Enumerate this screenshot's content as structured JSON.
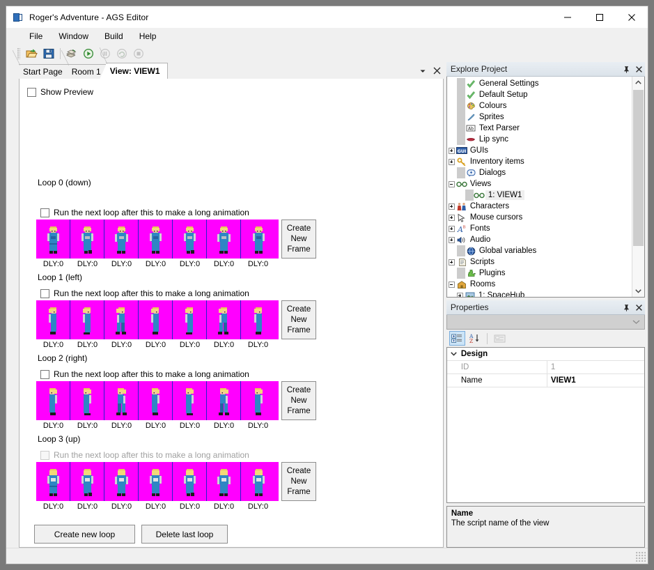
{
  "window": {
    "title": "Roger's Adventure - AGS Editor",
    "icon": "ags-app-icon",
    "controls": {
      "minimize": "minimize-icon",
      "maximize": "maximize-icon",
      "close": "close-icon"
    }
  },
  "menubar": {
    "items": [
      "File",
      "Window",
      "Build",
      "Help"
    ]
  },
  "toolbar": {
    "buttons": [
      {
        "name": "open-project-icon",
        "enabled": true
      },
      {
        "name": "save-icon",
        "enabled": true
      },
      {
        "name": "build-icon",
        "enabled": true
      },
      {
        "name": "run-icon",
        "enabled": true
      },
      {
        "name": "pause-icon",
        "enabled": false
      },
      {
        "name": "step-icon",
        "enabled": false
      },
      {
        "name": "stop-icon",
        "enabled": false
      }
    ]
  },
  "tabs": {
    "items": [
      {
        "label": "Start Page",
        "active": false
      },
      {
        "label": "Room 1",
        "active": false
      },
      {
        "label": "View: VIEW1",
        "active": true
      }
    ],
    "dropdown_icon": "chevron-down-icon",
    "close_icon": "close-icon"
  },
  "view_editor": {
    "show_preview": {
      "label": "Show Preview",
      "checked": false
    },
    "run_next_loop_label": "Run the next loop after this to make a long animation",
    "create_new_frame_label": "Create New Frame",
    "loops": [
      {
        "title": "Loop 0 (down)",
        "run_next_loop_checked": false,
        "run_next_loop_enabled": true,
        "pose": "front",
        "frames": [
          {
            "delay_label": "DLY:0"
          },
          {
            "delay_label": "DLY:0"
          },
          {
            "delay_label": "DLY:0"
          },
          {
            "delay_label": "DLY:0"
          },
          {
            "delay_label": "DLY:0"
          },
          {
            "delay_label": "DLY:0"
          },
          {
            "delay_label": "DLY:0"
          }
        ]
      },
      {
        "title": "Loop 1 (left)",
        "run_next_loop_checked": false,
        "run_next_loop_enabled": true,
        "pose": "left",
        "frames": [
          {
            "delay_label": "DLY:0"
          },
          {
            "delay_label": "DLY:0"
          },
          {
            "delay_label": "DLY:0"
          },
          {
            "delay_label": "DLY:0"
          },
          {
            "delay_label": "DLY:0"
          },
          {
            "delay_label": "DLY:0"
          },
          {
            "delay_label": "DLY:0"
          }
        ]
      },
      {
        "title": "Loop 2 (right)",
        "run_next_loop_checked": false,
        "run_next_loop_enabled": true,
        "pose": "right",
        "frames": [
          {
            "delay_label": "DLY:0"
          },
          {
            "delay_label": "DLY:0"
          },
          {
            "delay_label": "DLY:0"
          },
          {
            "delay_label": "DLY:0"
          },
          {
            "delay_label": "DLY:0"
          },
          {
            "delay_label": "DLY:0"
          },
          {
            "delay_label": "DLY:0"
          }
        ]
      },
      {
        "title": "Loop 3 (up)",
        "run_next_loop_checked": false,
        "run_next_loop_enabled": false,
        "pose": "back",
        "frames": [
          {
            "delay_label": "DLY:0"
          },
          {
            "delay_label": "DLY:0"
          },
          {
            "delay_label": "DLY:0"
          },
          {
            "delay_label": "DLY:0"
          },
          {
            "delay_label": "DLY:0"
          },
          {
            "delay_label": "DLY:0"
          },
          {
            "delay_label": "DLY:0"
          }
        ]
      }
    ],
    "create_new_loop_label": "Create new loop",
    "delete_last_loop_label": "Delete last loop",
    "frame_background_color": "#ff00ff",
    "frame_separator_color": "#2222cc"
  },
  "explore_project": {
    "title": "Explore Project",
    "pin_icon": "pin-icon",
    "close_icon": "close-icon",
    "nodes": [
      {
        "label": "General Settings",
        "icon": "green-check-icon",
        "expander": "none",
        "indent": 1,
        "selected": false
      },
      {
        "label": "Default Setup",
        "icon": "green-check-icon",
        "expander": "none",
        "indent": 1,
        "selected": false
      },
      {
        "label": "Colours",
        "icon": "palette-icon",
        "expander": "none",
        "indent": 1,
        "selected": false
      },
      {
        "label": "Sprites",
        "icon": "sprite-icon",
        "expander": "none",
        "indent": 1,
        "selected": false
      },
      {
        "label": "Text Parser",
        "icon": "text-parser-icon",
        "expander": "none",
        "indent": 1,
        "selected": false
      },
      {
        "label": "Lip sync",
        "icon": "lips-icon",
        "expander": "none",
        "indent": 1,
        "selected": false
      },
      {
        "label": "GUIs",
        "icon": "gui-icon",
        "expander": "plus",
        "indent": 0,
        "selected": false
      },
      {
        "label": "Inventory items",
        "icon": "key-icon",
        "expander": "plus",
        "indent": 0,
        "selected": false
      },
      {
        "label": "Dialogs",
        "icon": "dialog-icon",
        "expander": "none",
        "indent": 1,
        "selected": false
      },
      {
        "label": "Views",
        "icon": "views-icon",
        "expander": "minus",
        "indent": 0,
        "selected": false
      },
      {
        "label": "1: VIEW1",
        "icon": "views-icon",
        "expander": "none",
        "indent": 2,
        "selected": true
      },
      {
        "label": "Characters",
        "icon": "characters-icon",
        "expander": "plus",
        "indent": 0,
        "selected": false
      },
      {
        "label": "Mouse cursors",
        "icon": "cursor-icon",
        "expander": "plus",
        "indent": 0,
        "selected": false
      },
      {
        "label": "Fonts",
        "icon": "font-icon",
        "expander": "plus",
        "indent": 0,
        "selected": false
      },
      {
        "label": "Audio",
        "icon": "speaker-icon",
        "expander": "plus",
        "indent": 0,
        "selected": false
      },
      {
        "label": "Global variables",
        "icon": "globe-icon",
        "expander": "none",
        "indent": 1,
        "selected": false
      },
      {
        "label": "Scripts",
        "icon": "script-icon",
        "expander": "plus",
        "indent": 0,
        "selected": false
      },
      {
        "label": "Plugins",
        "icon": "plugin-icon",
        "expander": "none",
        "indent": 1,
        "selected": false
      },
      {
        "label": "Rooms",
        "icon": "rooms-icon",
        "expander": "minus",
        "indent": 0,
        "selected": false
      },
      {
        "label": "1: SpaceHub",
        "icon": "room-icon",
        "expander": "plus",
        "indent": 1,
        "selected": false
      }
    ],
    "scroll_up_icon": "chevron-up-icon",
    "scroll_down_icon": "chevron-down-icon"
  },
  "properties": {
    "title": "Properties",
    "pin_icon": "pin-icon",
    "close_icon": "close-icon",
    "object_selector_value": "",
    "object_selector_icon": "chevron-down-icon",
    "toolbar": [
      {
        "name": "categorized-view-button",
        "selected": true,
        "enabled": true
      },
      {
        "name": "alphabetical-sort-button",
        "selected": false,
        "enabled": true
      },
      {
        "name": "property-pages-button",
        "selected": false,
        "enabled": false
      }
    ],
    "category": {
      "label": "Design",
      "expander_icon": "chevron-down-icon"
    },
    "rows": [
      {
        "name": "ID",
        "value": "1",
        "greyed": true,
        "bold": false
      },
      {
        "name": "Name",
        "value": "VIEW1",
        "greyed": false,
        "bold": true
      }
    ],
    "help": {
      "title": "Name",
      "description": "The script name of the view"
    }
  }
}
